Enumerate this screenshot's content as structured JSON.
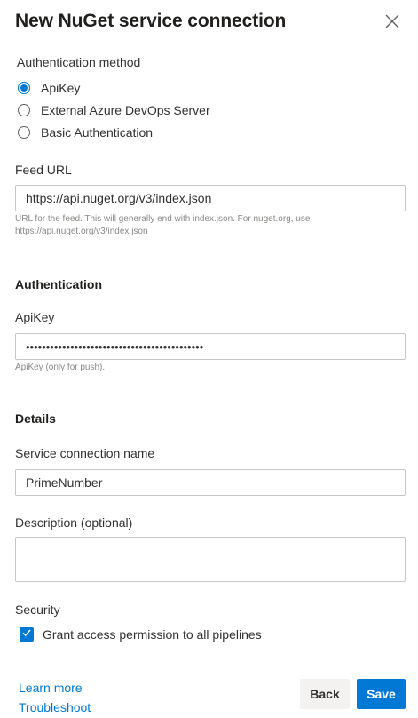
{
  "dialog": {
    "title": "New NuGet service connection",
    "close_icon": "close-icon"
  },
  "auth_method": {
    "label": "Authentication method",
    "options": [
      {
        "label": "ApiKey",
        "selected": true
      },
      {
        "label": "External Azure DevOps Server",
        "selected": false
      },
      {
        "label": "Basic Authentication",
        "selected": false
      }
    ]
  },
  "feed_url": {
    "label": "Feed URL",
    "value": "https://api.nuget.org/v3/index.json",
    "help_line1": "URL for the feed. This will generally end with index.json. For nuget.org, use",
    "help_line2": "https://api.nuget.org/v3/index.json"
  },
  "authentication": {
    "heading": "Authentication",
    "apikey_label": "ApiKey",
    "apikey_value": "••••••••••••••••••••••••••••••••••••••••••••",
    "apikey_help": "ApiKey (only for push)."
  },
  "details": {
    "heading": "Details",
    "name_label": "Service connection name",
    "name_value": "PrimeNumber",
    "description_label": "Description (optional)",
    "description_value": ""
  },
  "security": {
    "label": "Security",
    "grant_label": "Grant access permission to all pipelines",
    "grant_checked": true
  },
  "footer": {
    "learn_more": "Learn more",
    "troubleshoot": "Troubleshoot",
    "back_label": "Back",
    "save_label": "Save"
  },
  "colors": {
    "accent": "#0078d4",
    "border": "#c8c6c4",
    "secondary_button_bg": "#f3f2f1"
  }
}
